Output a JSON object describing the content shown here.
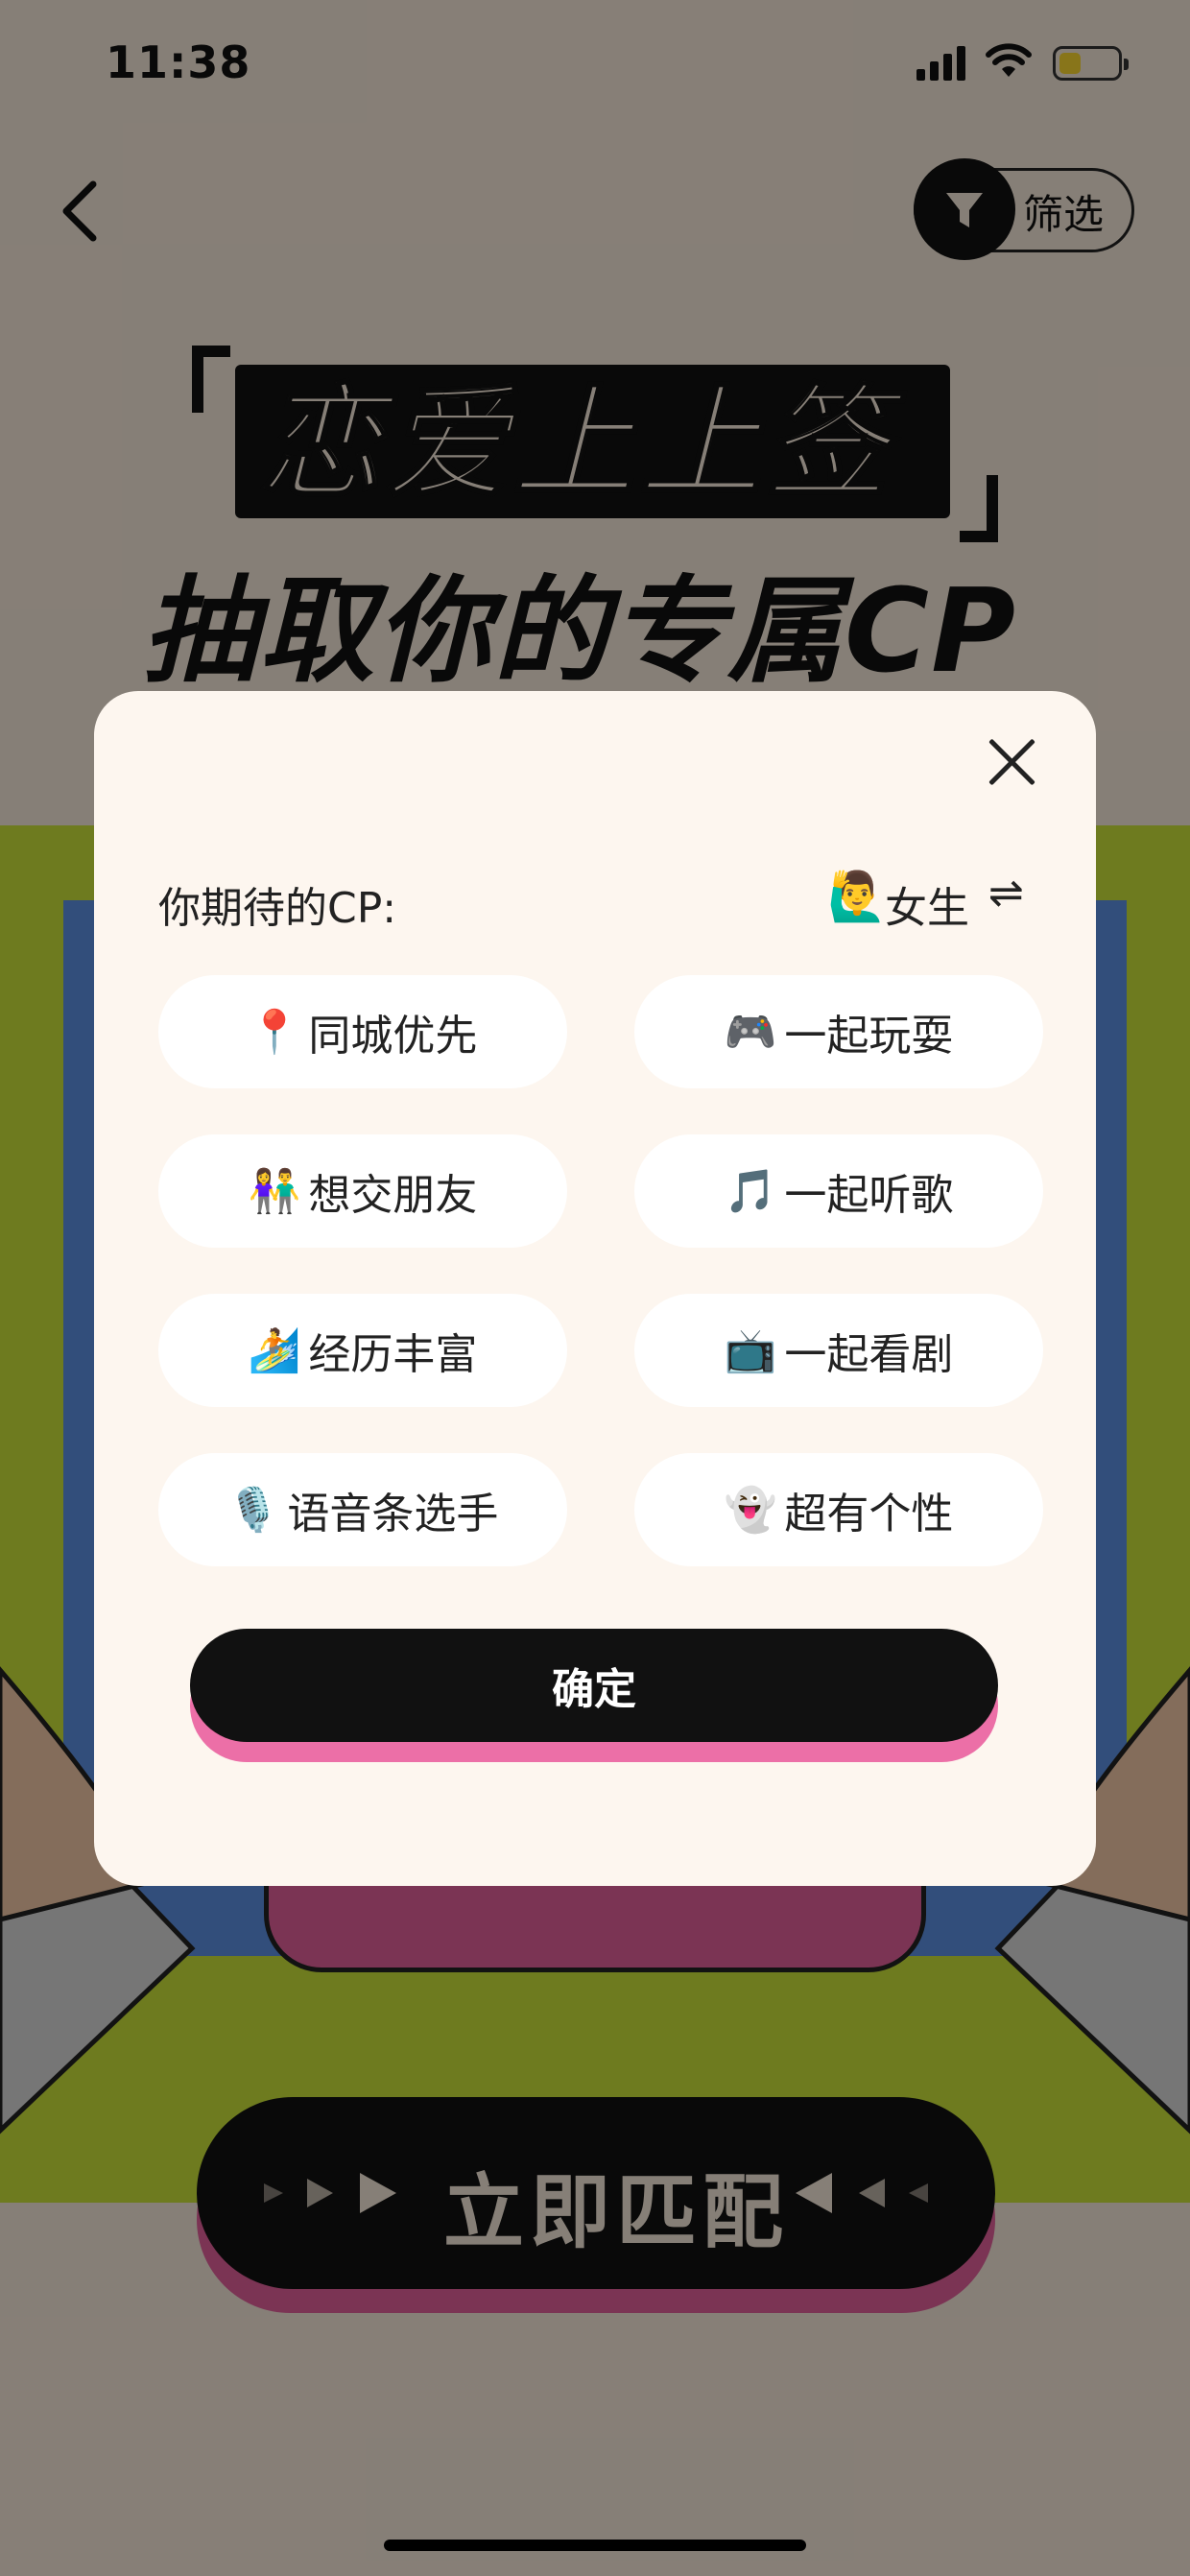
{
  "status_bar": {
    "time": "11:38"
  },
  "header": {
    "filter_label": "筛选"
  },
  "banner": {
    "title_line1": "恋爱上上签",
    "title_line2": "抽取你的专属CP"
  },
  "match_button": {
    "label": "立即匹配"
  },
  "modal": {
    "cp_label": "你期待的CP:",
    "gender_emoji": "🙋‍♂️",
    "gender": "女生",
    "swap_symbol": "⇌",
    "tags": [
      {
        "emoji": "📍",
        "label": "同城优先"
      },
      {
        "emoji": "🎮",
        "label": "一起玩耍"
      },
      {
        "emoji": "👫",
        "label": "想交朋友"
      },
      {
        "emoji": "🎵",
        "label": "一起听歌"
      },
      {
        "emoji": "🏄",
        "label": "经历丰富"
      },
      {
        "emoji": "📺",
        "label": "一起看剧"
      },
      {
        "emoji": "🎙️",
        "label": "语音条选手"
      },
      {
        "emoji": "👻",
        "label": "超有个性"
      }
    ],
    "confirm_label": "确定"
  },
  "colors": {
    "accent_pink": "#ec6fa7",
    "dark": "#111111",
    "modal_bg": "#fdf6ef"
  }
}
